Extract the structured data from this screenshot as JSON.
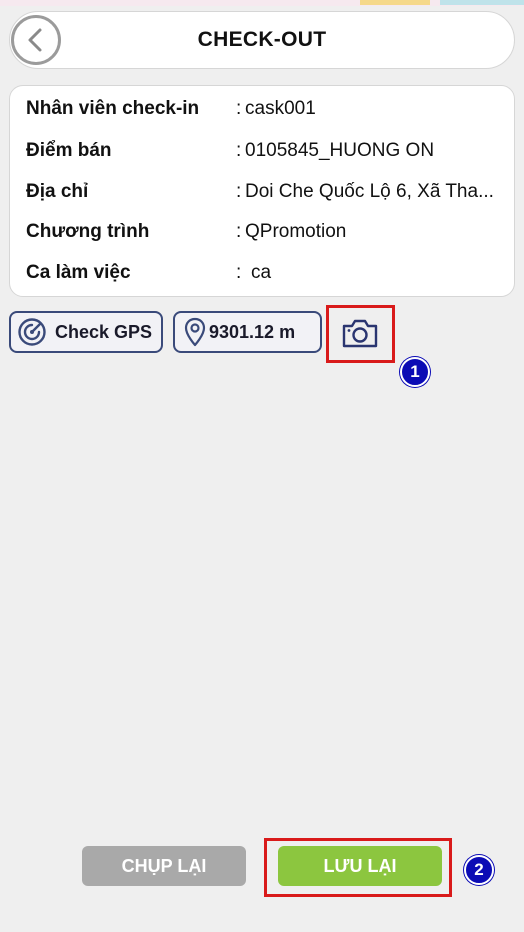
{
  "header": {
    "title": "CHECK-OUT",
    "back_icon": "chevron-left-icon"
  },
  "info": [
    {
      "label": "Nhân viên check-in",
      "value": "cask001"
    },
    {
      "label": "Điểm bán",
      "value": "0105845_HUONG ON"
    },
    {
      "label": "Địa chỉ",
      "value": "Doi Che Quốc Lộ 6, Xã Tha..."
    },
    {
      "label": "Chương trình",
      "value": "QPromotion"
    },
    {
      "label": "Ca làm việc",
      "value": "ca"
    }
  ],
  "actions": {
    "check_gps_label": "Check GPS",
    "distance_label": "9301.12 m",
    "camera_icon": "camera-icon"
  },
  "annotations": {
    "badge_1": "1",
    "badge_2": "2",
    "highlight_color": "#d91a1a",
    "badge_color": "#0b0bb5"
  },
  "footer": {
    "retake_label": "CHỤP LẠI",
    "save_label": "LƯU LẠI"
  },
  "colors": {
    "accent_green": "#8cc63f",
    "disabled_gray": "#a9a9a9",
    "outline_navy": "#3a4a7a"
  }
}
